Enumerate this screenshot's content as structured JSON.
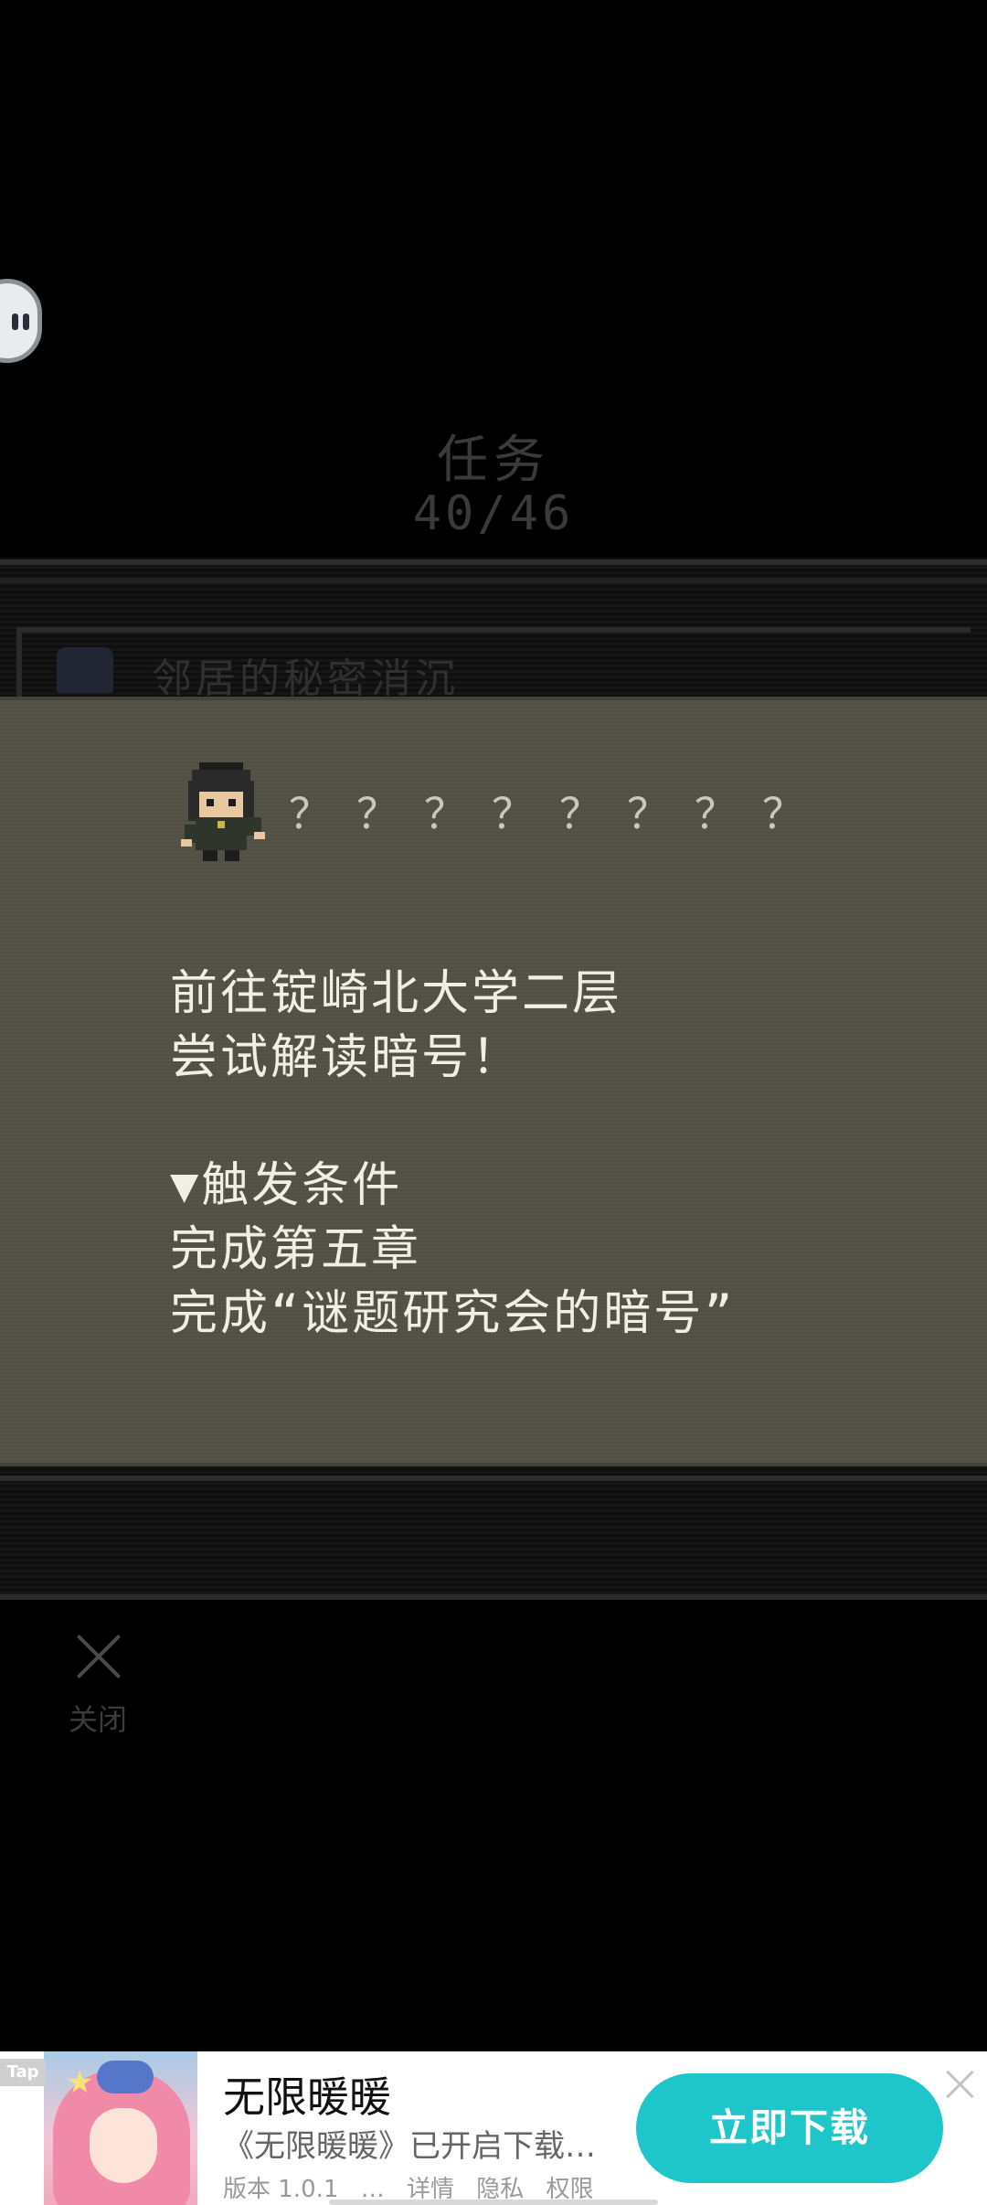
{
  "header": {
    "title": "任务",
    "count": "40/46"
  },
  "list_behind": {
    "row_title": "邻居的秘密消沉"
  },
  "dialog": {
    "hidden_name": "？？？？？？？？",
    "lines": [
      "前往锭崎北大学二层",
      "尝试解读暗号！",
      "",
      "▼触发条件",
      "完成第五章",
      "完成“谜题研究会的暗号”"
    ]
  },
  "close": {
    "label": "关闭"
  },
  "ad": {
    "tag": "Tap",
    "title": "无限暖暖",
    "subtitle": "《无限暖暖》已开启下载…",
    "meta": [
      "版本 1.0.1",
      "…",
      "详情",
      "隐私",
      "权限"
    ],
    "cta": "立即下载",
    "cta_color": "#1ec6c9"
  }
}
